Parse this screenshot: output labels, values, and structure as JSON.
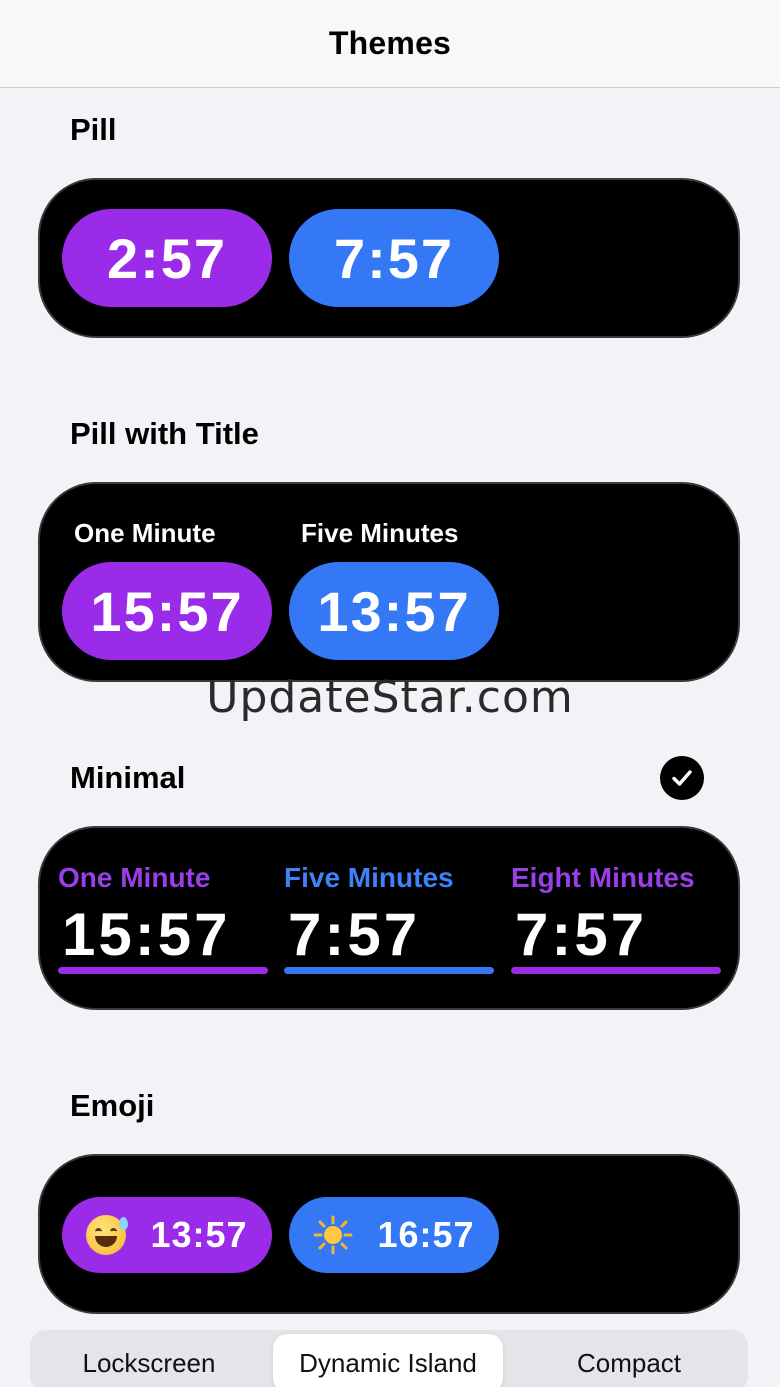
{
  "nav": {
    "title": "Themes"
  },
  "sections": {
    "pill": {
      "title": "Pill",
      "items": [
        {
          "time": "2:57",
          "color": "#9a2be8"
        },
        {
          "time": "7:57",
          "color": "#3478f6"
        }
      ]
    },
    "pill_title": {
      "title": "Pill with Title",
      "items": [
        {
          "label": "One Minute",
          "time": "15:57",
          "color": "#9a2be8"
        },
        {
          "label": "Five Minutes",
          "time": "13:57",
          "color": "#3478f6"
        }
      ]
    },
    "minimal": {
      "title": "Minimal",
      "selected": true,
      "items": [
        {
          "label": "One Minute",
          "time": "15:57",
          "color": "#9a2be8"
        },
        {
          "label": "Five Minutes",
          "time": "7:57",
          "color": "#3478f6"
        },
        {
          "label": "Eight Minutes",
          "time": "7:57",
          "color": "#9a2be8"
        }
      ]
    },
    "emoji": {
      "title": "Emoji",
      "items": [
        {
          "icon": "grinning-sweat-emoji-icon",
          "time": "13:57",
          "color": "#9a2be8"
        },
        {
          "icon": "sun-emoji-icon",
          "time": "16:57",
          "color": "#3478f6"
        }
      ]
    }
  },
  "watermark": "UpdateStar.com",
  "tabs": [
    {
      "label": "Lockscreen",
      "active": false
    },
    {
      "label": "Dynamic Island",
      "active": true
    },
    {
      "label": "Compact",
      "active": false
    }
  ]
}
